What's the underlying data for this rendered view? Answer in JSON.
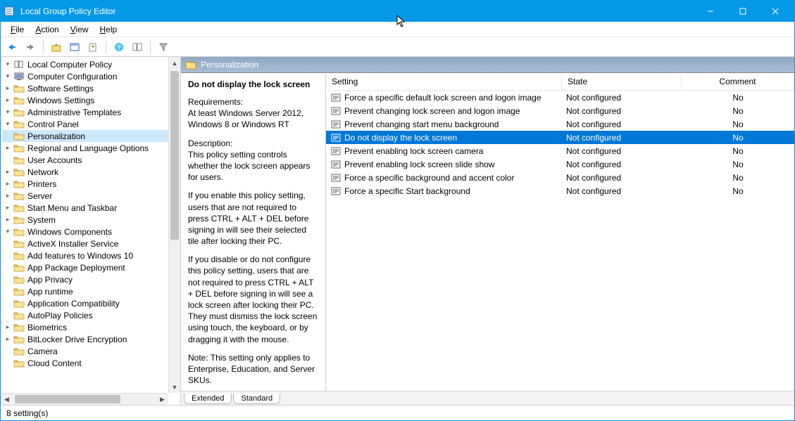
{
  "window": {
    "title": "Local Group Policy Editor",
    "minimize": "–",
    "maximize": "▢",
    "close": "✕"
  },
  "menu": {
    "file": "File",
    "action": "Action",
    "view": "View",
    "help": "Help"
  },
  "tree": {
    "root": "Local Computer Policy",
    "items": [
      {
        "label": "Computer Configuration",
        "indent": 1,
        "open": true,
        "twisty": "open",
        "icon": "pc"
      },
      {
        "label": "Software Settings",
        "indent": 2,
        "twisty": "closed"
      },
      {
        "label": "Windows Settings",
        "indent": 2,
        "twisty": "closed"
      },
      {
        "label": "Administrative Templates",
        "indent": 2,
        "twisty": "open"
      },
      {
        "label": "Control Panel",
        "indent": 3,
        "twisty": "open"
      },
      {
        "label": "Personalization",
        "indent": 4,
        "selected": true
      },
      {
        "label": "Regional and Language Options",
        "indent": 4,
        "twisty": "closed"
      },
      {
        "label": "User Accounts",
        "indent": 4
      },
      {
        "label": "Network",
        "indent": 3,
        "twisty": "closed"
      },
      {
        "label": "Printers",
        "indent": 3,
        "twisty": "closed"
      },
      {
        "label": "Server",
        "indent": 3,
        "twisty": "closed"
      },
      {
        "label": "Start Menu and Taskbar",
        "indent": 3,
        "twisty": "closed"
      },
      {
        "label": "System",
        "indent": 3,
        "twisty": "closed"
      },
      {
        "label": "Windows Components",
        "indent": 3,
        "twisty": "open"
      },
      {
        "label": "ActiveX Installer Service",
        "indent": 4
      },
      {
        "label": "Add features to Windows 10",
        "indent": 4
      },
      {
        "label": "App Package Deployment",
        "indent": 4
      },
      {
        "label": "App Privacy",
        "indent": 4
      },
      {
        "label": "App runtime",
        "indent": 4
      },
      {
        "label": "Application Compatibility",
        "indent": 4
      },
      {
        "label": "AutoPlay Policies",
        "indent": 4
      },
      {
        "label": "Biometrics",
        "indent": 4,
        "twisty": "closed"
      },
      {
        "label": "BitLocker Drive Encryption",
        "indent": 4,
        "twisty": "closed"
      },
      {
        "label": "Camera",
        "indent": 4
      },
      {
        "label": "Cloud Content",
        "indent": 4
      }
    ]
  },
  "path": {
    "title": "Personalization"
  },
  "desc": {
    "title": "Do not display the lock screen",
    "req_label": "Requirements:",
    "req_text": "At least Windows Server 2012, Windows 8 or Windows RT",
    "desc_label": "Description:",
    "p1": "This policy setting controls whether the lock screen appears for users.",
    "p2": "If you enable this policy setting, users that are not required to press CTRL + ALT + DEL before signing in will see their selected tile after locking their PC.",
    "p3": "If you disable or do not configure this policy setting, users that are not required to press CTRL + ALT + DEL before signing in will see a lock screen after locking their PC. They must dismiss the lock screen using touch, the keyboard, or by dragging it with the mouse.",
    "p4": "Note: This setting only applies to Enterprise, Education, and Server SKUs."
  },
  "list": {
    "headers": {
      "setting": "Setting",
      "state": "State",
      "comment": "Comment"
    },
    "rows": [
      {
        "setting": "Force a specific default lock screen and logon image",
        "state": "Not configured",
        "comment": "No"
      },
      {
        "setting": "Prevent changing lock screen and logon image",
        "state": "Not configured",
        "comment": "No"
      },
      {
        "setting": "Prevent changing start menu background",
        "state": "Not configured",
        "comment": "No"
      },
      {
        "setting": "Do not display the lock screen",
        "state": "Not configured",
        "comment": "No",
        "selected": true
      },
      {
        "setting": "Prevent enabling lock screen camera",
        "state": "Not configured",
        "comment": "No"
      },
      {
        "setting": "Prevent enabling lock screen slide show",
        "state": "Not configured",
        "comment": "No"
      },
      {
        "setting": "Force a specific background and accent color",
        "state": "Not configured",
        "comment": "No"
      },
      {
        "setting": "Force a specific Start background",
        "state": "Not configured",
        "comment": "No"
      }
    ]
  },
  "tabs": {
    "extended": "Extended",
    "standard": "Standard"
  },
  "status": {
    "text": "8 setting(s)"
  }
}
